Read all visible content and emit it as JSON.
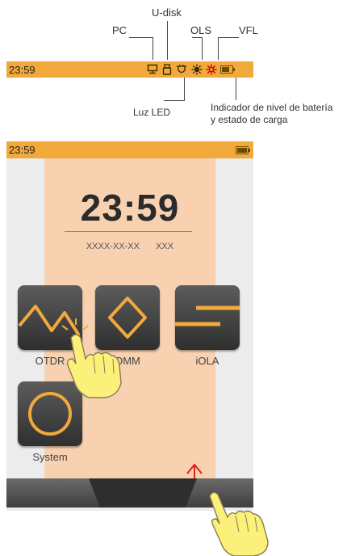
{
  "annotations": {
    "pc": "PC",
    "udisk": "U-disk",
    "ols": "OLS",
    "vfl": "VFL",
    "led": "Luz LED",
    "battery_line1": "Indicador de nivel de batería",
    "battery_line2": "y estado de carga"
  },
  "status_bar_detail": {
    "time": "23:59",
    "battery_level": 0.75,
    "icons": [
      "pc-icon",
      "udisk-icon",
      "led-icon",
      "ols-icon",
      "vfl-icon",
      "battery-icon"
    ]
  },
  "device": {
    "status_bar": {
      "time": "23:59",
      "battery_level": 1.0
    },
    "clock": {
      "time": "23:59",
      "date": "XXXX-XX-XX",
      "weekday": "XXX"
    },
    "apps": [
      {
        "label": "OTDR",
        "icon": "otdr-trace-icon"
      },
      {
        "label": "OMM",
        "icon": "omm-diamond-icon"
      },
      {
        "label": "iOLA",
        "icon": "iola-lines-icon"
      },
      {
        "label": "System",
        "icon": "system-circle-icon"
      }
    ]
  },
  "colors": {
    "accent": "#f2a93b",
    "highlight": "#f7d1b0",
    "icon_bg": "#3a3a3a",
    "swipe_arrow": "#e02020"
  }
}
